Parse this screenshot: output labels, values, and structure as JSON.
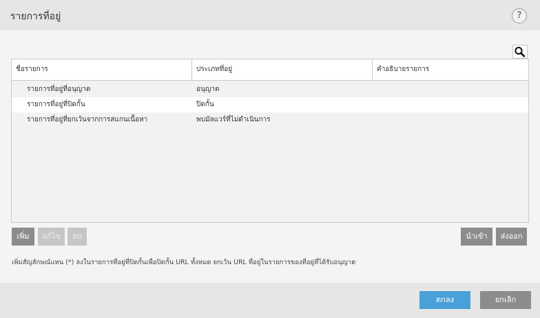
{
  "dialog": {
    "title": "รายการที่อยู่",
    "help_label": "?"
  },
  "table": {
    "columns": [
      "ชื่อรายการ",
      "ประเภทที่อยู่",
      "คำอธิบายรายการ"
    ],
    "rows": [
      {
        "name": "รายการที่อยู่ที่อนุญาต",
        "type": "อนุญาต",
        "description": ""
      },
      {
        "name": "รายการที่อยู่ที่ปิดกั้น",
        "type": "ปิดกั้น",
        "description": ""
      },
      {
        "name": "รายการที่อยู่ที่ยกเว้นจากการสแกนเนื้อหา",
        "type": "พบมัลแวร์ที่ไม่ดำเนินการ",
        "description": ""
      }
    ]
  },
  "toolbar": {
    "add_label": "เพิ่ม",
    "edit_label": "แก้ไข",
    "delete_label": "ลบ",
    "import_label": "นำเข้า",
    "export_label": "ส่งออก"
  },
  "note": "เพิ่มสัญลักษณ์แทน (*) ลงในรายการที่อยู่ที่ปิดกั้นเพื่อปิดกั้น URL ทั้งหมด ยกเว้น URL ที่อยู่ในรายการของที่อยู่ที่ได้รับอนุญาต",
  "footer": {
    "ok_label": "ตกลง",
    "cancel_label": "ยกเลิก"
  },
  "colors": {
    "accent": "#4aa0d8",
    "button_gray": "#8c8c8c",
    "button_disabled": "#c6c6c6"
  }
}
